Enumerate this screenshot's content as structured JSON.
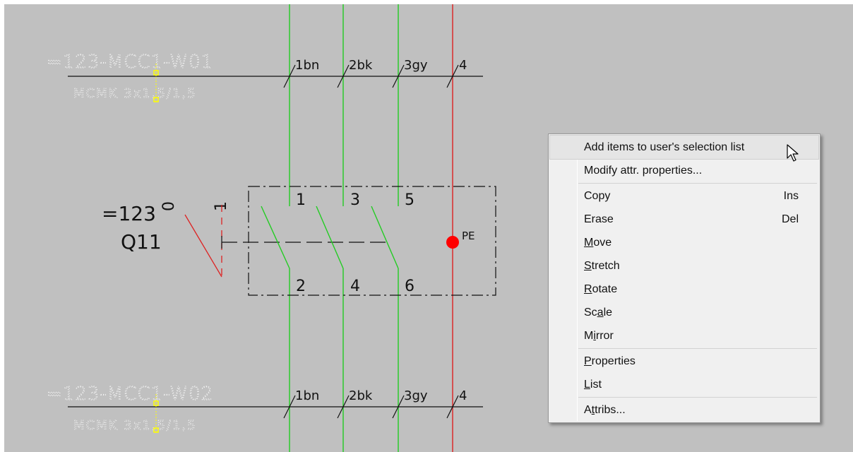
{
  "drawing": {
    "cable1": {
      "tag": "=123-MCC1-W01",
      "type": "MCMK 3x1,5/1,5"
    },
    "cable2": {
      "tag": "=123-MCC1-W02",
      "type": "MCMK 3x1,5/1,5"
    },
    "conductors": [
      "1bn",
      "2bk",
      "3gy",
      "4"
    ],
    "switch": {
      "function": "=123",
      "device": "Q11",
      "pos_off": "0",
      "pos_on": "1",
      "terminals_top": [
        "1",
        "3",
        "5"
      ],
      "terminals_bottom": [
        "2",
        "4",
        "6"
      ],
      "pe_label": "PE"
    },
    "colors": {
      "background": "#c0c0c0",
      "wire_green": "#22cc22",
      "wire_red": "#dd2222",
      "grip": "#ffff00",
      "pe_dot": "#ff0000"
    }
  },
  "context_menu": {
    "items": [
      {
        "id": "add-items",
        "label": "Add items to user's selection list",
        "highlighted": true
      },
      {
        "id": "modify-attr",
        "label": "Modify attr. properties..."
      },
      {
        "separator": true
      },
      {
        "id": "copy",
        "label": "Copy",
        "shortcut": "Ins"
      },
      {
        "id": "erase",
        "label": "Erase",
        "shortcut": "Del"
      },
      {
        "id": "move",
        "label": "Move",
        "mnemonic": "M"
      },
      {
        "id": "stretch",
        "label": "Stretch",
        "mnemonic": "S"
      },
      {
        "id": "rotate",
        "label": "Rotate",
        "mnemonic": "R"
      },
      {
        "id": "scale",
        "label": "Scale",
        "mnemonic": "a"
      },
      {
        "id": "mirror",
        "label": "Mirror",
        "mnemonic": "i"
      },
      {
        "separator": true
      },
      {
        "id": "properties",
        "label": "Properties",
        "mnemonic": "P"
      },
      {
        "id": "list",
        "label": "List",
        "mnemonic": "L"
      },
      {
        "separator": true
      },
      {
        "id": "attribs",
        "label": "Attribs...",
        "mnemonic": "t"
      }
    ]
  }
}
